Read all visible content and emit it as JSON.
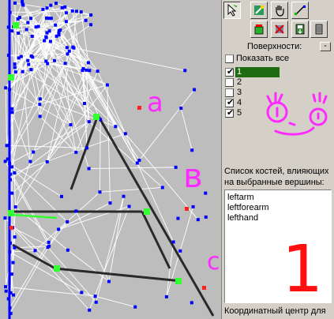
{
  "toolbar": {
    "row1": [
      {
        "icon": "select-pointer-icon",
        "pressed": true
      },
      {
        "icon": "paint-vertex-icon",
        "pressed": false
      },
      {
        "icon": "hand-pan-icon",
        "pressed": false
      },
      {
        "icon": "ruler-measure-icon",
        "pressed": false
      }
    ],
    "row2": [
      {
        "icon": "fill-surface-icon",
        "pressed": false
      },
      {
        "icon": "remove-weight-icon",
        "pressed": false
      },
      {
        "icon": "save-weights-icon",
        "pressed": false
      },
      {
        "icon": "delete-object-icon",
        "pressed": false
      }
    ]
  },
  "surfaces": {
    "header": "Поверхности:",
    "collapse_label": "-",
    "show_all_label": "Показать все",
    "show_all_checked": false,
    "items": [
      {
        "label": "1",
        "checked": true,
        "selected": true
      },
      {
        "label": "2",
        "checked": false,
        "selected": false
      },
      {
        "label": "3",
        "checked": false,
        "selected": false
      },
      {
        "label": "4",
        "checked": true,
        "selected": false
      },
      {
        "label": "5",
        "checked": true,
        "selected": false
      }
    ]
  },
  "bones": {
    "caption_line1": "Список костей, влияющих",
    "caption_line2": "на выбранные вершины:",
    "list": [
      "leftarm",
      "leftforearm",
      "lefthand"
    ]
  },
  "coord_center_label": "Координатный центр для",
  "annotations": {
    "a": "a",
    "b": "в",
    "c": "c",
    "one": "1"
  },
  "colors": {
    "viewport_bg": "#bdbdbd",
    "panel_bg": "#d4d0c8",
    "vertex_blue": "#0000ff",
    "vertex_green": "#33ff33",
    "vertex_red": "#ff2020",
    "annotation_magenta": "#ff2aff",
    "selection_green": "#1e6b12"
  }
}
